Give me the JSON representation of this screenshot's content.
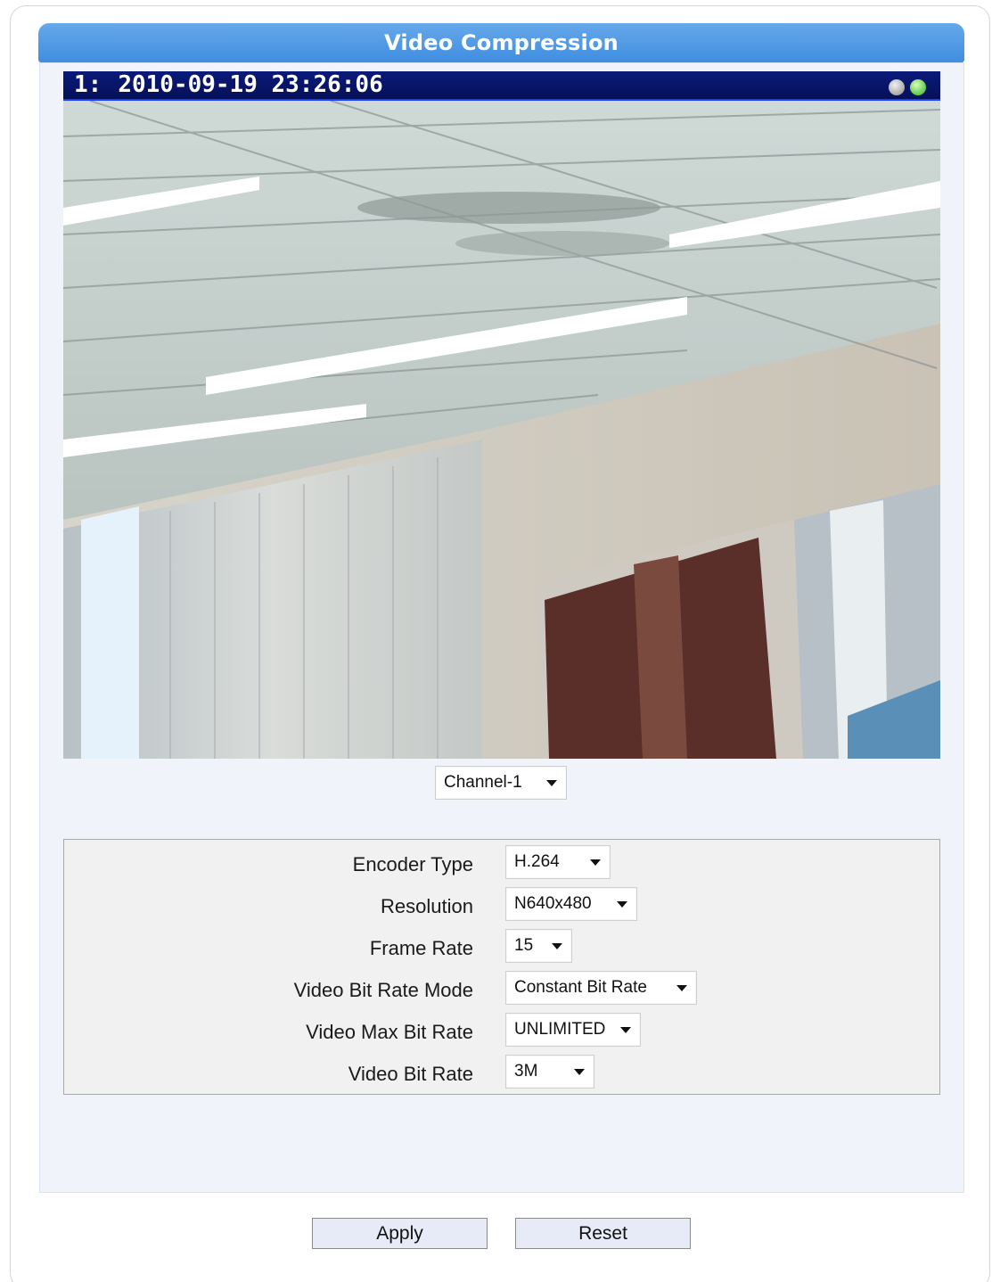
{
  "title": "Video Compression",
  "video": {
    "channel_number": "1:",
    "timestamp": "2010-09-19 23:26:06"
  },
  "channel_select": {
    "value": "Channel-1"
  },
  "settings": {
    "encoder_type": {
      "label": "Encoder Type",
      "value": "H.264"
    },
    "resolution": {
      "label": "Resolution",
      "value": "N640x480"
    },
    "frame_rate": {
      "label": "Frame Rate",
      "value": "15"
    },
    "bit_rate_mode": {
      "label": "Video Bit Rate Mode",
      "value": "Constant Bit Rate"
    },
    "max_bit_rate": {
      "label": "Video Max Bit Rate",
      "value": "UNLIMITED"
    },
    "bit_rate": {
      "label": "Video Bit Rate",
      "value": "3M"
    }
  },
  "buttons": {
    "apply": "Apply",
    "reset": "Reset"
  },
  "colors": {
    "title_bar": "#4a96e4",
    "panel_bg": "#f1f3fb",
    "video_header": "#061058",
    "button_bg": "#e7ebf7"
  }
}
